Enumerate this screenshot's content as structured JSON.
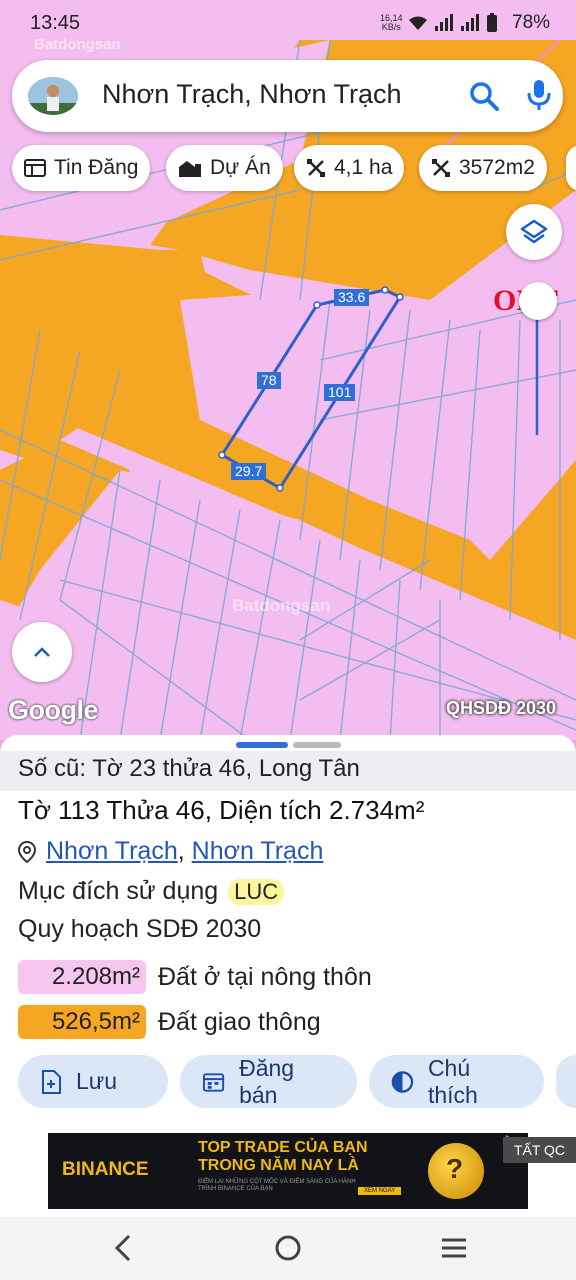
{
  "status": {
    "time": "13:45",
    "net_speed": "16,14",
    "net_unit": "KB/s",
    "battery": "78%"
  },
  "watermark": "Batdongsan",
  "search": {
    "query": "Nhơn Trạch, Nhơn Trạch"
  },
  "chips": [
    {
      "label": "Tin Đăng",
      "icon": "listing-icon"
    },
    {
      "label": "Dự Án",
      "icon": "buildings-icon"
    },
    {
      "label": "4,1 ha",
      "icon": "measure-icon"
    },
    {
      "label": "3572m2",
      "icon": "measure-icon"
    }
  ],
  "map": {
    "edge_labels": {
      "top": "33.6",
      "left": "78",
      "right": "101",
      "bottom": "29.7"
    },
    "zone_code": "ONT",
    "google": "Google",
    "overlay": "QHSDĐ 2030"
  },
  "sheet": {
    "old_ref": "Số cũ: Tờ 23 thửa 46, Long Tân",
    "title": "Tờ 113 Thửa 46, Diện tích 2.734m²",
    "location": [
      "Nhơn Trạch",
      "Nhơn Trạch"
    ],
    "location_sep": ",",
    "purpose_label": "Mục đích sử dụng",
    "purpose_code": "LUC",
    "plan_label": "Quy hoạch SDĐ 2030",
    "zones": [
      {
        "area": "2.208m²",
        "name": "Đất ở tại nông thôn",
        "color": "#f6c6f0"
      },
      {
        "area": "526,5m²",
        "name": "Đất giao thông",
        "color": "#f5a623"
      }
    ],
    "actions": [
      {
        "label": "Lưu",
        "icon": "save-icon"
      },
      {
        "label": "Đăng bán",
        "icon": "calendar-icon"
      },
      {
        "label": "Chú thích",
        "icon": "contrast-icon"
      }
    ]
  },
  "ad": {
    "close_label": "TẤT QC",
    "brand": "BINANCE",
    "headline1": "TOP TRADE CỦA BẠN",
    "headline2": "TRONG NĂM NAY LÀ",
    "fine_print": "ĐIỂM LẠI NHỮNG CỘT MỐC VÀ ĐIỂM SÁNG CỦA HÀNH TRÌNH BINANCE CỦA BẠN",
    "cta": "XEM NGAY",
    "coin_glyph": "?"
  },
  "colors": {
    "road": "#f5a623",
    "residential": "#f4bdf0",
    "boundary": "#2f6fd6",
    "accent": "#1a73e8"
  }
}
